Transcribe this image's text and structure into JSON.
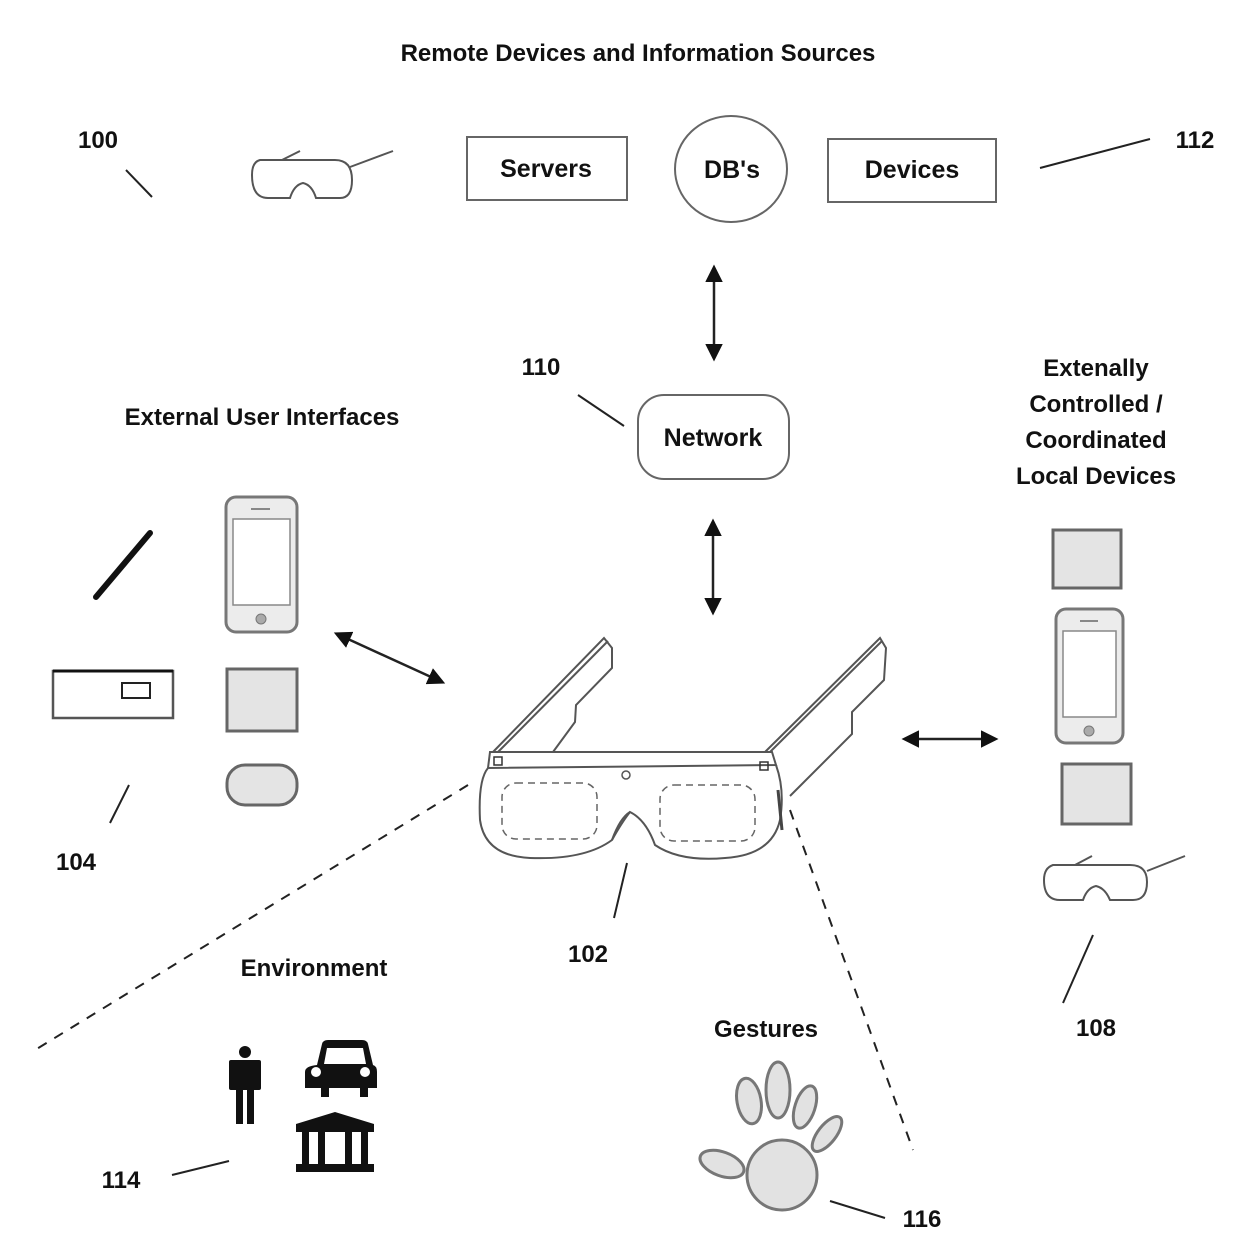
{
  "title": "Remote Devices and Information Sources",
  "remote_row": {
    "servers": "Servers",
    "dbs": "DB's",
    "devices": "Devices"
  },
  "network": "Network",
  "headings": {
    "external_ui": "External User Interfaces",
    "local_devices": [
      "Extenally",
      "Controlled /",
      "Coordinated",
      "Local Devices"
    ],
    "environment": "Environment",
    "gestures": "Gestures"
  },
  "refs": {
    "r100": "100",
    "r102": "102",
    "r104": "104",
    "r108": "108",
    "r110": "110",
    "r112": "112",
    "r114": "114",
    "r116": "116"
  },
  "icons": {
    "remote": [
      "headset-glasses-icon",
      "servers-box",
      "database-circle",
      "devices-box"
    ],
    "external_ui": [
      "stylus-icon",
      "smartphone-icon",
      "keyboard-icon",
      "tablet-icon",
      "mouse-icon"
    ],
    "local_devices": [
      "tablet-icon",
      "smartphone-icon",
      "tablet-icon",
      "headset-glasses-icon"
    ],
    "environment": [
      "person-icon",
      "car-icon",
      "building-icon"
    ],
    "gestures": [
      "hand-icon"
    ]
  }
}
